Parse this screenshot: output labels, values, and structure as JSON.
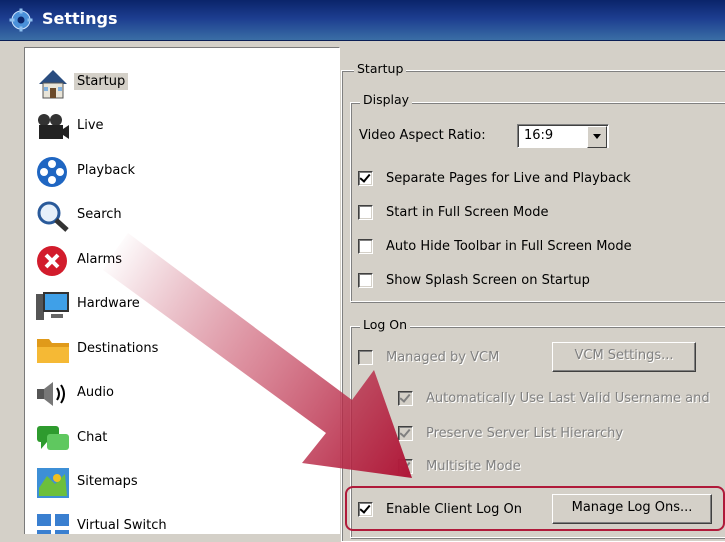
{
  "window": {
    "title": "Settings"
  },
  "nav": {
    "items": [
      {
        "label": "Startup",
        "icon": "house-icon",
        "selected": true
      },
      {
        "label": "Live",
        "icon": "video-camera-icon"
      },
      {
        "label": "Playback",
        "icon": "playback-icon"
      },
      {
        "label": "Search",
        "icon": "magnifier-icon"
      },
      {
        "label": "Alarms",
        "icon": "alarm-x-icon"
      },
      {
        "label": "Hardware",
        "icon": "computer-icon"
      },
      {
        "label": "Destinations",
        "icon": "folder-icon"
      },
      {
        "label": "Audio",
        "icon": "speaker-icon"
      },
      {
        "label": "Chat",
        "icon": "chat-bubble-icon"
      },
      {
        "label": "Sitemaps",
        "icon": "map-icon"
      },
      {
        "label": "Virtual Switch",
        "icon": "virtual-switch-icon"
      }
    ]
  },
  "startup": {
    "group_label": "Startup",
    "display": {
      "group_label": "Display",
      "aspect_label": "Video Aspect Ratio:",
      "aspect_value": "16:9",
      "options": [
        {
          "label": "Separate Pages for Live and Playback",
          "checked": true
        },
        {
          "label": "Start in Full Screen Mode",
          "checked": false
        },
        {
          "label": "Auto Hide Toolbar in Full Screen Mode",
          "checked": false
        },
        {
          "label": "Show Splash Screen on Startup",
          "checked": false
        }
      ]
    },
    "logon": {
      "group_label": "Log On",
      "managed_label": "Managed by VCM",
      "vcm_button": "VCM Settings...",
      "sub_options": [
        {
          "label": "Automatically Use Last Valid Username and",
          "checked": true
        },
        {
          "label": "Preserve Server List Hierarchy",
          "checked": true
        },
        {
          "label": "Multisite Mode",
          "checked": true
        }
      ],
      "enable_label": "Enable Client Log On",
      "enable_checked": true,
      "manage_button": "Manage Log Ons..."
    }
  },
  "colors": {
    "annotation": "#b01a3a",
    "title_bar": "#0a246a"
  }
}
